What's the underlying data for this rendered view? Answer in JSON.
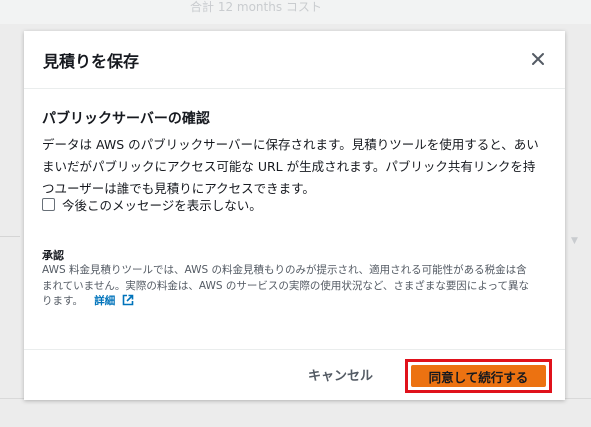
{
  "background": {
    "header_text": "合計 12 months コスト"
  },
  "modal": {
    "title": "見積りを保存",
    "section_title": "パブリックサーバーの確認",
    "body_lines": [
      "データは AWS のパブリックサーバーに保存されます。見積りツールを使用すると、あい",
      "まいだがパブリックにアクセス可能な URL が生成されます。パブリック共有リンクを持",
      "つユーザーは誰でも見積りにアクセスできます。"
    ],
    "checkbox_label": "今後このメッセージを表示しない。",
    "checkbox_checked": false,
    "ack_title": "承認",
    "ack_lines": [
      "AWS 料金見積りツールでは、AWS の料金見積もりのみが提示され、適用される可能性がある税金は含",
      "まれていません。実際の料金は、AWS のサービスの実際の使用状況など、さまざまな要因によって異な",
      "ります。"
    ],
    "details_link": "詳細",
    "cancel_label": "キャンセル",
    "confirm_label": "同意して続行する"
  },
  "colors": {
    "primary_button": "#ec7211",
    "link": "#0073bb",
    "highlight_border": "#e0111b"
  },
  "icons": {
    "close": "close-icon",
    "external": "external-link-icon"
  }
}
